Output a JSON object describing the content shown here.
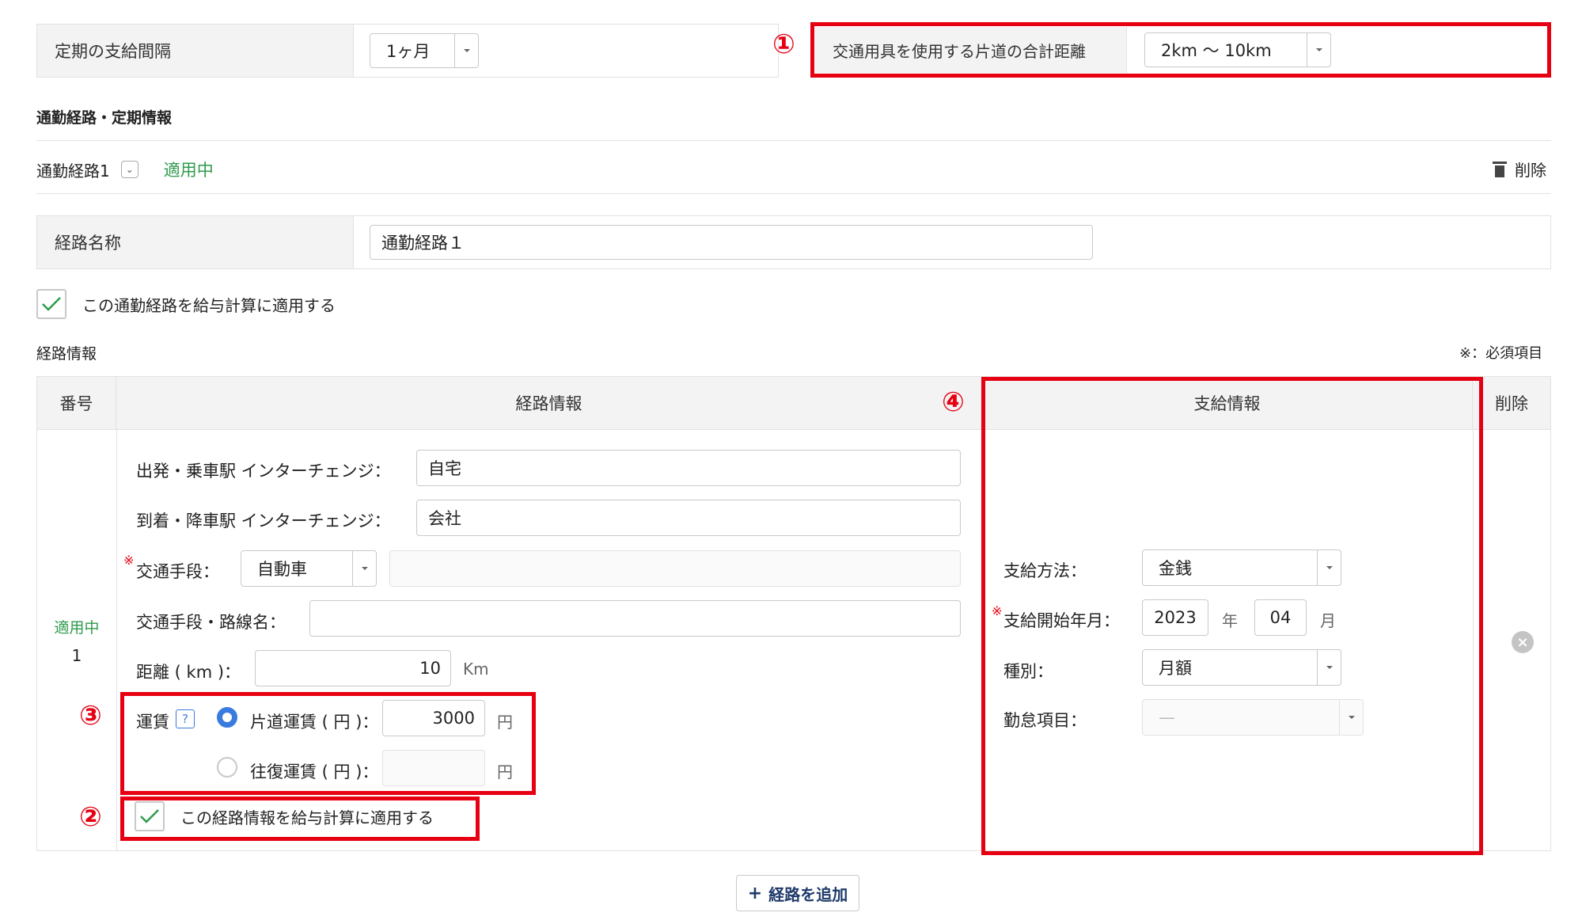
{
  "top": {
    "pay_interval_label": "定期の支給間隔",
    "pay_interval_value": "1ヶ月",
    "distance_label": "交通用具を使用する片道の合計距離",
    "distance_value": "2km 〜 10km"
  },
  "section_title": "通勤経路・定期情報",
  "route_tab": {
    "name": "通勤経路1",
    "status": "適用中",
    "delete_label": "削除"
  },
  "route_name": {
    "label": "経路名称",
    "value": "通勤経路１"
  },
  "apply_route_label": "この通勤経路を給与計算に適用する",
  "route_info_title": "経路情報",
  "required_note": "※：必須項目",
  "table": {
    "headers": {
      "number": "番号",
      "route": "経路情報",
      "payment": "支給情報",
      "delete": "削除"
    },
    "row": {
      "status": "適用中",
      "number": "1",
      "departure_label": "出発・乗車駅 インターチェンジ：",
      "departure_value": "自宅",
      "arrival_label": "到着・降車駅 インターチェンジ：",
      "arrival_value": "会社",
      "transport_label": "交通手段：",
      "transport_value": "自動車",
      "line_label": "交通手段・路線名：",
      "distance_label": "距離 ( km )：",
      "distance_value": "10",
      "distance_unit": "Km",
      "fare_label": "運賃",
      "help_icon": "?",
      "oneway_label": "片道運賃 ( 円 )：",
      "oneway_value": "3000",
      "roundtrip_label": "往復運賃 ( 円 )：",
      "yen": "円",
      "apply_info_label": "この経路情報を給与計算に適用する",
      "pay_method_label": "支給方法：",
      "pay_method_value": "金銭",
      "start_label": "支給開始年月：",
      "start_year": "2023",
      "year_unit": "年",
      "start_month": "04",
      "month_unit": "月",
      "type_label": "種別：",
      "type_value": "月額",
      "attendance_label": "勤怠項目：",
      "attendance_value": "—"
    }
  },
  "add_route_label": "経路を追加",
  "annotations": [
    "①",
    "②",
    "③",
    "④"
  ],
  "colors": {
    "accent_red": "#e60012",
    "green": "#2e9b4b",
    "radio_blue": "#3a7be0"
  }
}
